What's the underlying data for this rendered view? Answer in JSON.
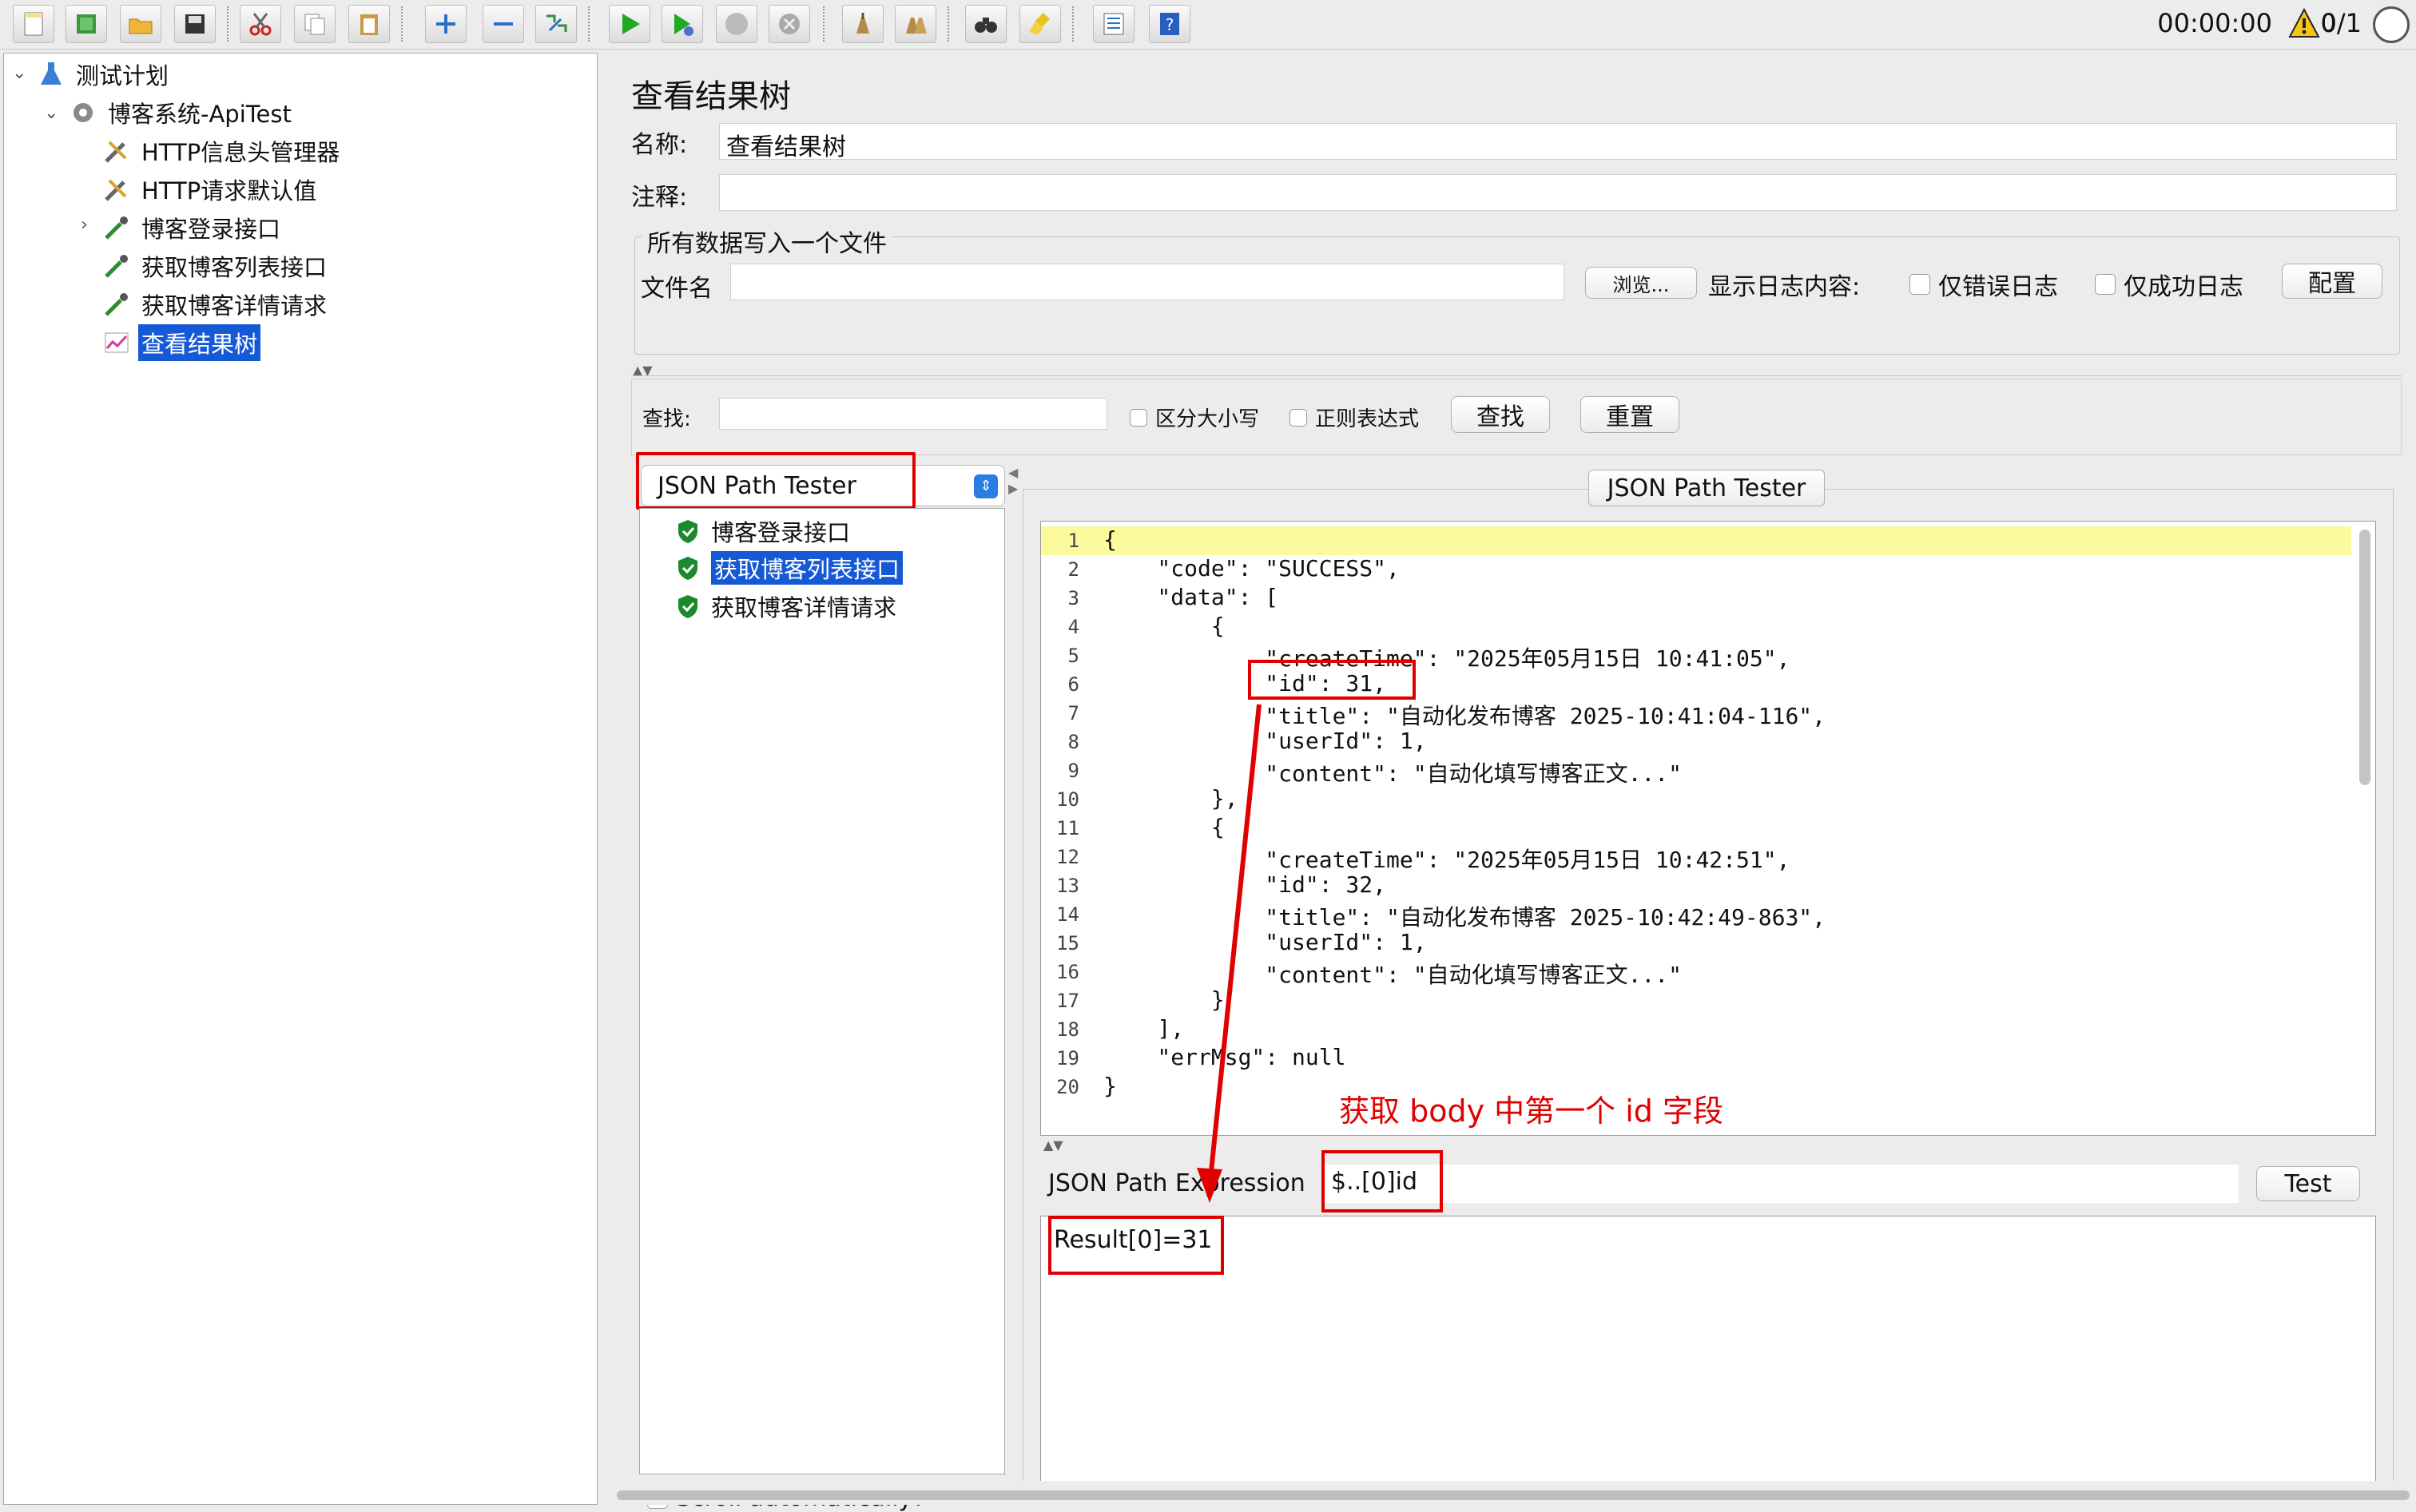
{
  "toolbar": {
    "icons": [
      "new-file-icon",
      "templates-icon",
      "open-icon",
      "save-icon",
      "cut-icon",
      "copy-icon",
      "paste-icon",
      "expand-icon",
      "collapse-icon",
      "toggle-icon",
      "start-icon",
      "start-no-pause-icon",
      "stop-icon",
      "shutdown-icon",
      "clear-icon",
      "clear-all-icon",
      "search-icon",
      "reset-search-icon",
      "function-helper-icon",
      "help-icon"
    ],
    "timer": "00:00:00",
    "warning_count": "0",
    "threads": "0/1"
  },
  "tree": {
    "items": [
      {
        "label": "测试计划",
        "icon": "test-plan-icon"
      },
      {
        "label": "博客系统-ApiTest",
        "icon": "thread-group-icon"
      },
      {
        "label": "HTTP信息头管理器",
        "icon": "wrench-icon"
      },
      {
        "label": "HTTP请求默认值",
        "icon": "wrench-icon"
      },
      {
        "label": "博客登录接口",
        "icon": "sampler-icon"
      },
      {
        "label": "获取博客列表接口",
        "icon": "sampler-icon"
      },
      {
        "label": "获取博客详情请求",
        "icon": "sampler-icon"
      },
      {
        "label": "查看结果树",
        "icon": "listener-icon"
      }
    ]
  },
  "panel": {
    "title": "查看结果树",
    "name_label": "名称:",
    "name_value": "查看结果树",
    "comment_label": "注释:",
    "comment_value": "",
    "file_group_label": "所有数据写入一个文件",
    "filename_label": "文件名",
    "browse_label": "浏览...",
    "log_content_label": "显示日志内容:",
    "errors_only_label": "仅错误日志",
    "success_only_label": "仅成功日志",
    "configure_label": "配置",
    "search_label": "查找:",
    "case_sensitive_label": "区分大小写",
    "regex_label": "正则表达式",
    "find_button": "查找",
    "reset_button": "重置",
    "renderer_selected": "JSON Path Tester",
    "tester_tab": "JSON Path Tester",
    "scroll_auto_label": "Scroll automatically?"
  },
  "results": [
    {
      "label": "博客登录接口",
      "status": "success"
    },
    {
      "label": "获取博客列表接口",
      "status": "success"
    },
    {
      "label": "获取博客详情请求",
      "status": "success"
    }
  ],
  "code_lines": [
    {
      "n": "1",
      "t": "{"
    },
    {
      "n": "2",
      "t": "    \"code\": \"SUCCESS\","
    },
    {
      "n": "3",
      "t": "    \"data\": ["
    },
    {
      "n": "4",
      "t": "        {"
    },
    {
      "n": "5",
      "t": "            \"createTime\": \"2025年05月15日 10:41:05\","
    },
    {
      "n": "6",
      "t": "            \"id\": 31,"
    },
    {
      "n": "7",
      "t": "            \"title\": \"自动化发布博客 2025-10:41:04-116\","
    },
    {
      "n": "8",
      "t": "            \"userId\": 1,"
    },
    {
      "n": "9",
      "t": "            \"content\": \"自动化填写博客正文...\""
    },
    {
      "n": "10",
      "t": "        },"
    },
    {
      "n": "11",
      "t": "        {"
    },
    {
      "n": "12",
      "t": "            \"createTime\": \"2025年05月15日 10:42:51\","
    },
    {
      "n": "13",
      "t": "            \"id\": 32,"
    },
    {
      "n": "14",
      "t": "            \"title\": \"自动化发布博客 2025-10:42:49-863\","
    },
    {
      "n": "15",
      "t": "            \"userId\": 1,"
    },
    {
      "n": "16",
      "t": "            \"content\": \"自动化填写博客正文...\""
    },
    {
      "n": "17",
      "t": "        }"
    },
    {
      "n": "18",
      "t": "    ],"
    },
    {
      "n": "19",
      "t": "    \"errMsg\": null"
    },
    {
      "n": "20",
      "t": "}"
    }
  ],
  "json_path": {
    "label": "JSON Path Expression",
    "value": "$..[0]id",
    "test_button": "Test",
    "result": "Result[0]=31"
  },
  "annotation": "获取 body 中第一个 id 字段",
  "colors": {
    "selection": "#1659d6",
    "highlight": "#fbfb9e",
    "annotation": "#e00000"
  }
}
